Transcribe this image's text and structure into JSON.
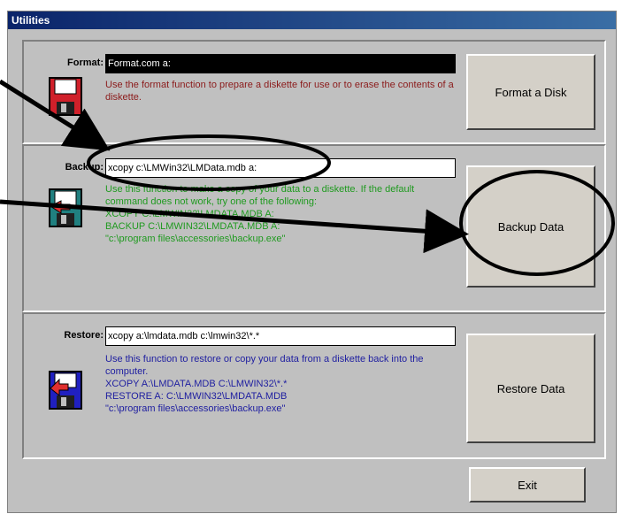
{
  "window": {
    "title": "Utilities"
  },
  "format": {
    "label": "Format:",
    "command": "Format.com a:",
    "description": "Use the format function to prepare a diskette for use or to erase the contents of a diskette.",
    "button": "Format a Disk",
    "desc_color": "#8b1a1a"
  },
  "backup": {
    "label": "Backup:",
    "command": "xcopy c:\\LMWin32\\LMData.mdb a:",
    "description": "Use this function to make a copy of your data to a diskette. If the default command does not work, try one of the following:\nXCOPY  C:\\LMWIN32\\LMDATA.MDB  A:\nBACKUP  C:\\LMWIN32\\LMDATA.MDB  A:\n\"c:\\program files\\accessories\\backup.exe\"",
    "button": "Backup Data",
    "desc_color": "#1f9a1f"
  },
  "restore": {
    "label": "Restore:",
    "command": "xcopy a:\\lmdata.mdb c:\\lmwin32\\*.*",
    "description": "Use this function to restore or copy your data from a diskette back into the computer.\nXCOPY  A:\\LMDATA.MDB  C:\\LMWIN32\\*.*\nRESTORE  A:  C:\\LMWIN32\\LMDATA.MDB\n\"c:\\program files\\accessories\\backup.exe\"",
    "button": "Restore Data",
    "desc_color": "#1e1ea0"
  },
  "exit_button": "Exit",
  "icons": {
    "format": "floppy-disk-red-icon",
    "backup": "floppy-disk-teal-icon",
    "restore": "floppy-disk-blue-icon"
  }
}
